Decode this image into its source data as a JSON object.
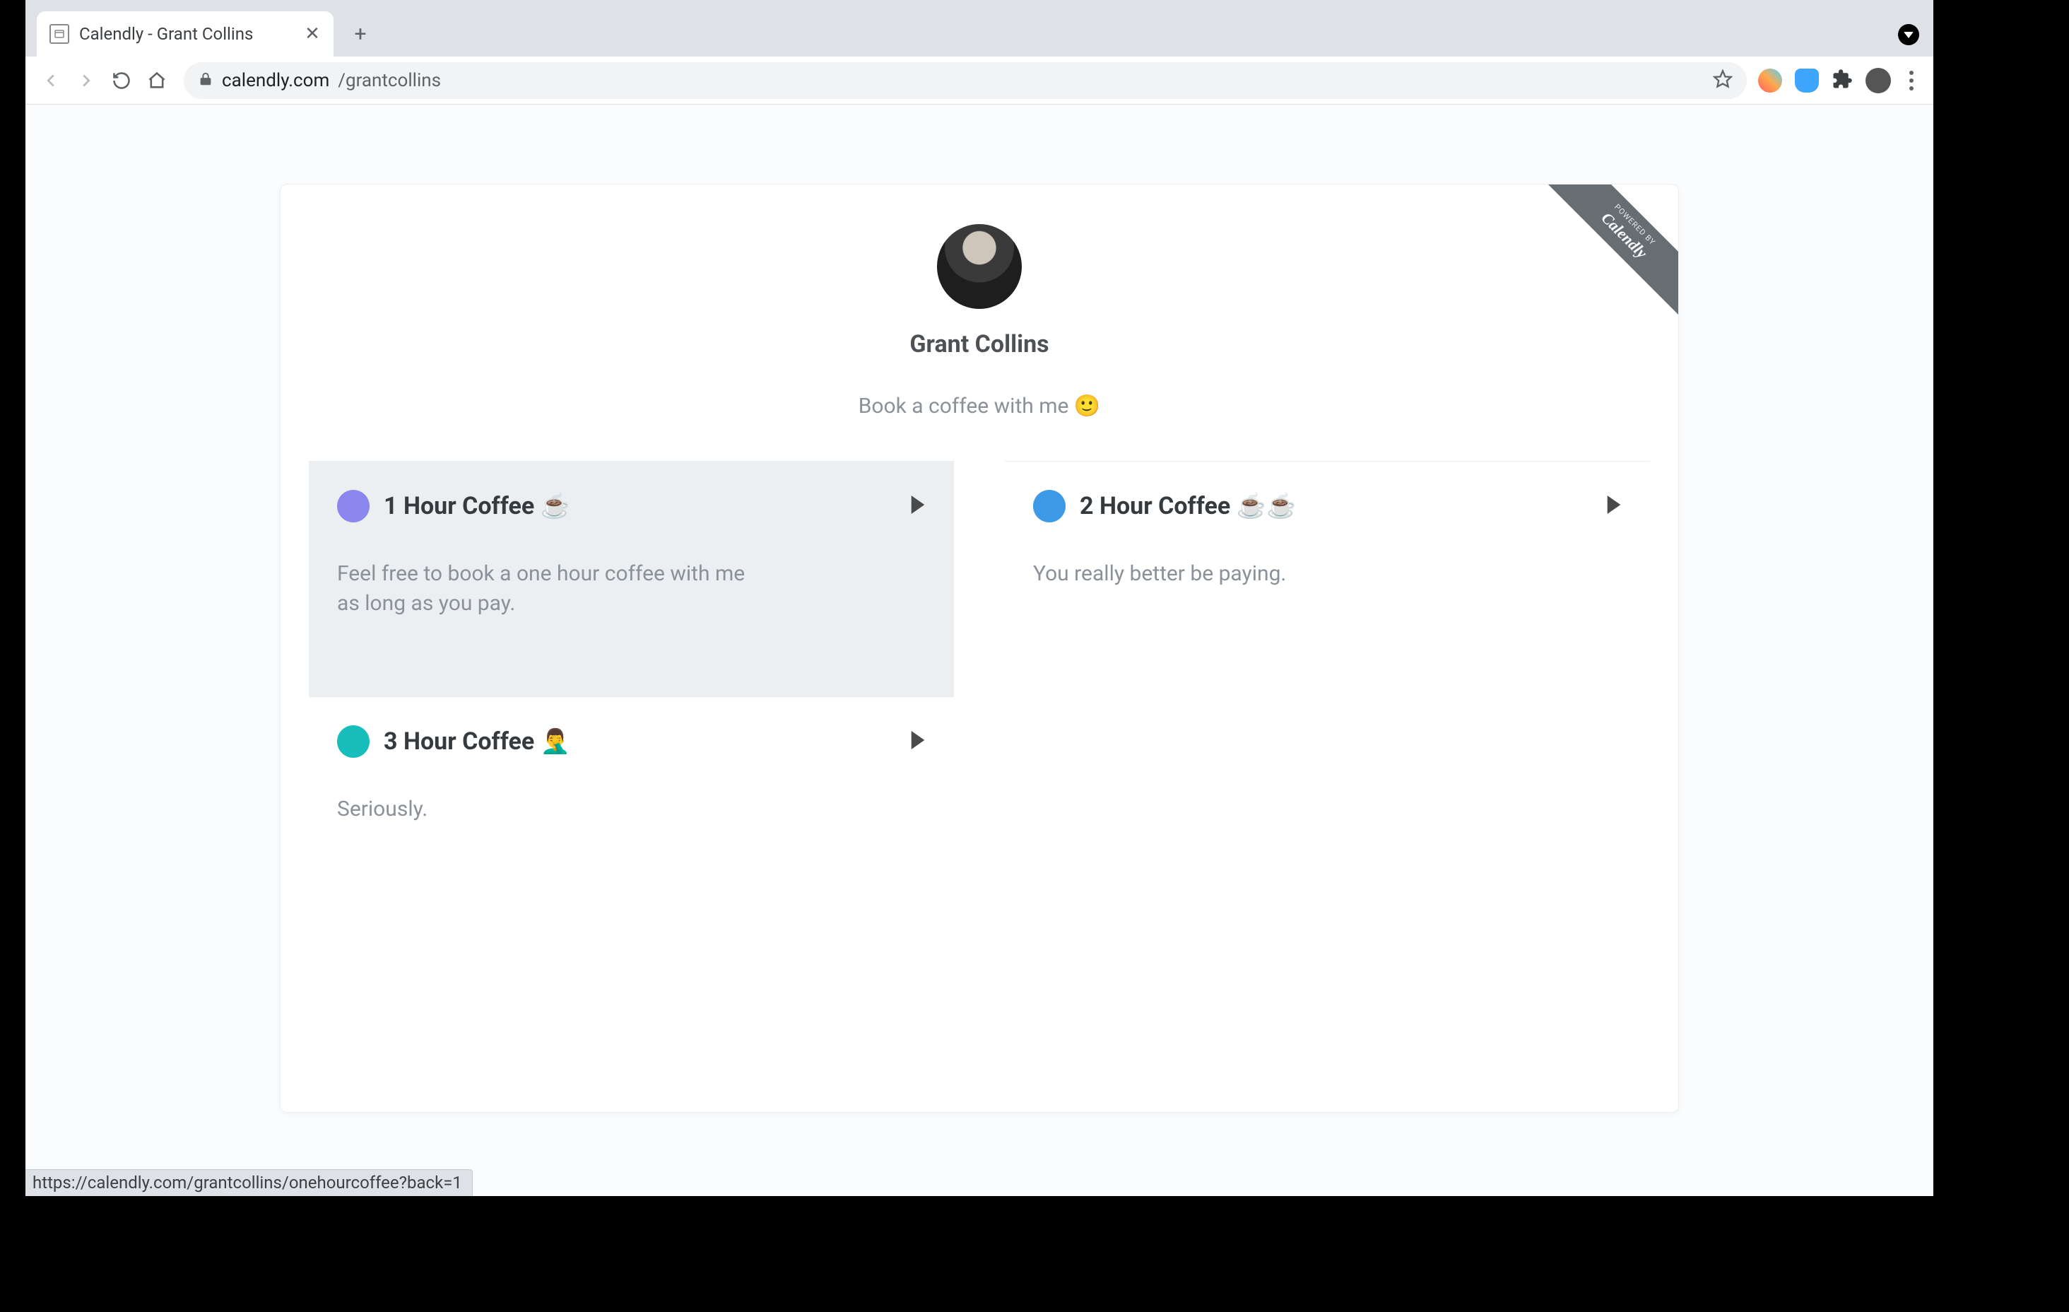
{
  "browser": {
    "tab_title": "Calendly - Grant Collins",
    "url_host": "calendly.com",
    "url_path": "/grantcollins",
    "status_url": "https://calendly.com/grantcollins/onehourcoffee?back=1"
  },
  "ribbon": {
    "line1": "POWERED BY",
    "line2": "Calendly"
  },
  "profile": {
    "name": "Grant Collins",
    "bio": "Book a coffee with me 🙂"
  },
  "events": [
    {
      "title": "1 Hour Coffee ☕",
      "description": "Feel free to book a one hour coffee with me as long as you pay.",
      "color": "#8b85ee",
      "hovered": true
    },
    {
      "title": "2 Hour Coffee ☕☕",
      "description": "You really better be paying.",
      "color": "#3b99e8",
      "hovered": false
    },
    {
      "title": "3 Hour Coffee 🤦‍♂️",
      "description": "Seriously.",
      "color": "#17bebb",
      "hovered": false
    }
  ]
}
